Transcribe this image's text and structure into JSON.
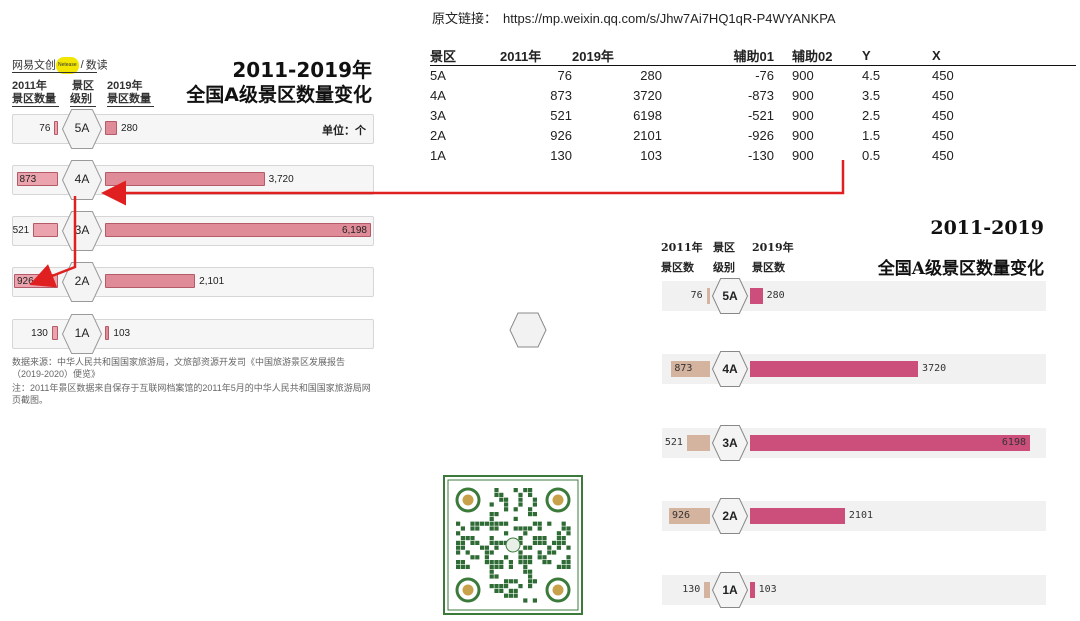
{
  "link": {
    "label": "原文链接：",
    "url": "https://mp.weixin.qq.com/s/Jhw7Ai7HQ1qR-P4WYANKPA"
  },
  "table": {
    "headers": [
      "景区",
      "2011年",
      "2019年",
      "辅助01",
      "辅助02",
      "Y",
      "X"
    ],
    "rows": [
      [
        "5A",
        "76",
        "280",
        "-76",
        "900",
        "4.5",
        "450"
      ],
      [
        "4A",
        "873",
        "3720",
        "-873",
        "900",
        "3.5",
        "450"
      ],
      [
        "3A",
        "521",
        "6198",
        "-521",
        "900",
        "2.5",
        "450"
      ],
      [
        "2A",
        "926",
        "2101",
        "-926",
        "900",
        "1.5",
        "450"
      ],
      [
        "1A",
        "130",
        "103",
        "-130",
        "900",
        "0.5",
        "450"
      ]
    ]
  },
  "left": {
    "brand": "网易文创",
    "brand_badge": "Netease",
    "brand_section": "数读",
    "title_line1": "2011-2019年",
    "title_line2": "全国A级景区数量变化",
    "col1_line1": "2011年",
    "col1_line2": "景区数量",
    "col2_line1": "景区",
    "col2_line2": "级别",
    "col3_line1": "2019年",
    "col3_line2": "景区数量",
    "unit": "单位：个",
    "values_2011": [
      "76",
      "873",
      "521",
      "926",
      "130"
    ],
    "values_2019": [
      "280",
      "3,720",
      "6,198",
      "2,101",
      "103"
    ],
    "note1": "数据来源：中华人民共和国国家旅游局，文旅部资源开发司《中国旅游景区发展报告（2019-2020）便览》",
    "note2": "注：2011年景区数据来自保存于互联网档案馆的2011年5月的中华人民共和国国家旅游局网页截图。"
  },
  "right": {
    "title_line1": "2011-2019",
    "title_line2": "全国A级景区数量变化",
    "col1_line1": "2011年",
    "col1_line2": "景区数",
    "col2_line1": "景区",
    "col2_line2": "级别",
    "col3_line1": "2019年",
    "col3_line2": "景区数",
    "values_2011": [
      "76",
      "873",
      "521",
      "926",
      "130"
    ],
    "values_2019": [
      "280",
      "3720",
      "6198",
      "2101",
      "103"
    ]
  },
  "colors": {
    "pink": "#e08c98",
    "pink_light": "#eba3ad",
    "crimson": "#cc4f7b",
    "tan": "#d4b39f",
    "arrow": "#e02020"
  },
  "chart_data": [
    {
      "type": "bar",
      "title": "2011-2019年 全国A级景区数量变化",
      "categories": [
        "5A",
        "4A",
        "3A",
        "2A",
        "1A"
      ],
      "series": [
        {
          "name": "2011年",
          "values": [
            76,
            873,
            521,
            926,
            130
          ]
        },
        {
          "name": "2019年",
          "values": [
            280,
            3720,
            6198,
            2101,
            103
          ]
        }
      ]
    },
    {
      "type": "bar",
      "title": "2011-2019 全国A级景区数量变化",
      "categories": [
        "5A",
        "4A",
        "3A",
        "2A",
        "1A"
      ],
      "series": [
        {
          "name": "2011年",
          "values": [
            76,
            873,
            521,
            926,
            130
          ]
        },
        {
          "name": "2019年",
          "values": [
            280,
            3720,
            6198,
            2101,
            103
          ]
        }
      ]
    }
  ]
}
